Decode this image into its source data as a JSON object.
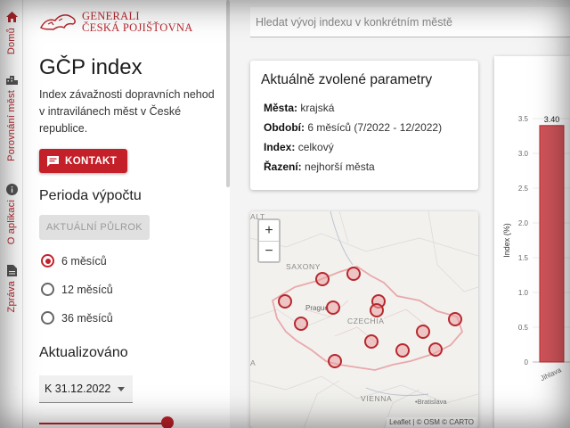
{
  "nav": {
    "home": "Domů",
    "compare": "Porovnání měst",
    "about": "O aplikaci",
    "report": "Zpráva"
  },
  "logo": {
    "line1": "GENERALI",
    "line2": "ČESKÁ POJIŠŤOVNA"
  },
  "sidebar": {
    "title": "GČP index",
    "description": "Index závažnosti dopravních nehod v intravilánech měst v České republice.",
    "contact_button": "KONTAKT",
    "period_heading": "Perioda výpočtu",
    "half_button": "AKTUÁLNÍ PŮLROK",
    "periods": [
      {
        "label": "6 měsíců",
        "selected": true
      },
      {
        "label": "12 měsíců",
        "selected": false
      },
      {
        "label": "36 měsíců",
        "selected": false
      }
    ],
    "updated_heading": "Aktualizováno",
    "updated_value": "K 31.12.2022"
  },
  "search": {
    "placeholder": "Hledat vývoj indexu v konkrétním městě"
  },
  "params": {
    "title": "Aktuálně zvolené parametry",
    "rows": [
      {
        "key": "Města:",
        "value": "krajská"
      },
      {
        "key": "Období:",
        "value": "6 měsíců (7/2022 - 12/2022)"
      },
      {
        "key": "Index:",
        "value": "celkový"
      },
      {
        "key": "Řazení:",
        "value": "nejhorší města"
      }
    ]
  },
  "map": {
    "zoom_in": "+",
    "zoom_out": "−",
    "labels": {
      "alt": "ALT",
      "saxony": "SAXONY",
      "prague": "Prague",
      "czechia": "CZECHIA",
      "vienna": "VIENNA",
      "bratislava": "•Bratislava",
      "a": "A"
    },
    "attribution": "Leaflet | © OSM © CARTO"
  },
  "colors": {
    "brand": "#c4202a",
    "marker": "#c4343a"
  },
  "chart_data": {
    "type": "bar",
    "ylabel": "Index (%)",
    "ylim": [
      0,
      3.5
    ],
    "yticks": [
      "0",
      "0.5",
      "1.0",
      "1.5",
      "2.0",
      "2.5",
      "3.0",
      "3.5"
    ],
    "categories": [
      "Jihlava"
    ],
    "values": [
      3.4
    ],
    "value_labels": [
      "3.40"
    ]
  }
}
